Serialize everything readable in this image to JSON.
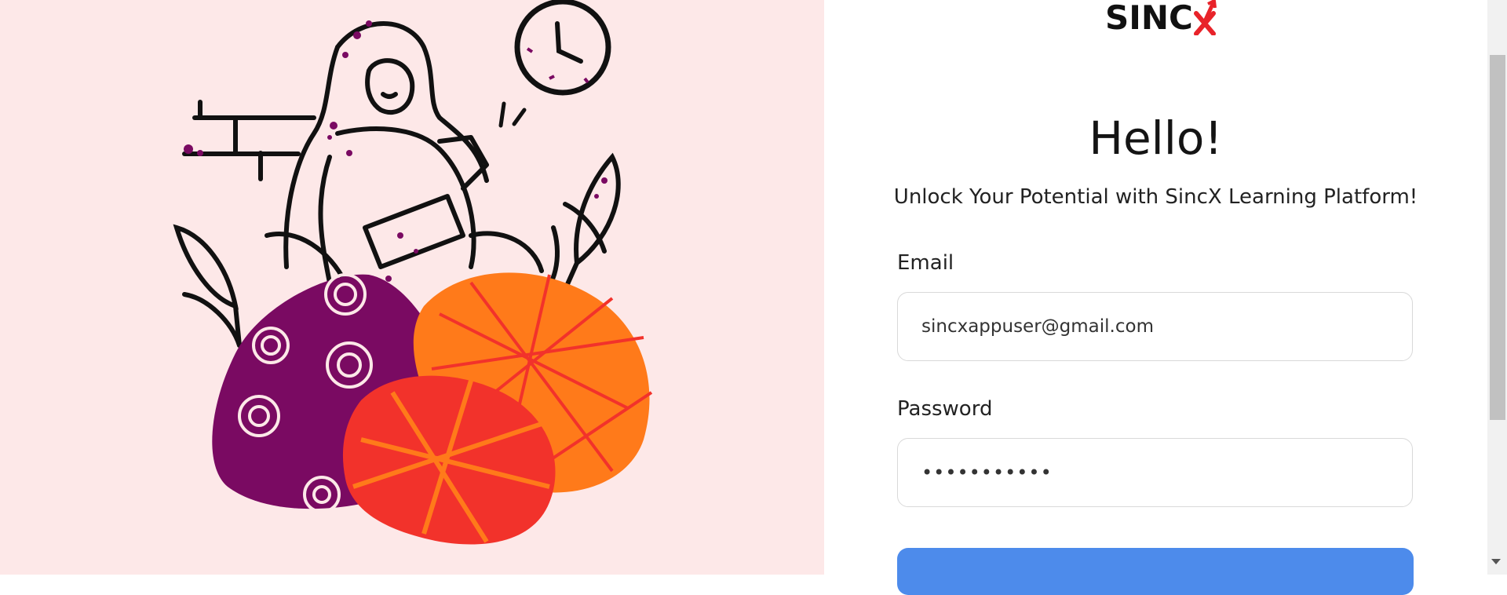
{
  "logo": {
    "text": "SINC"
  },
  "hero": {
    "title": "Hello!",
    "subtitle": "Unlock Your Potential with SincX Learning Platform!"
  },
  "form": {
    "email_label": "Email",
    "email_value": "sincxappuser@gmail.com",
    "password_label": "Password",
    "password_value": "•••••••••••"
  },
  "colors": {
    "left_panel_bg": "#fde8e8",
    "accent_blue": "#4d8beb",
    "purple": "#7a0a62",
    "orange": "#ff7a1a",
    "red": "#f2322b",
    "logo_red": "#e8232a"
  },
  "icons": {
    "logo_mark": "red-x-with-arrow-icon",
    "illustration": "person-with-laptop-illustration"
  }
}
